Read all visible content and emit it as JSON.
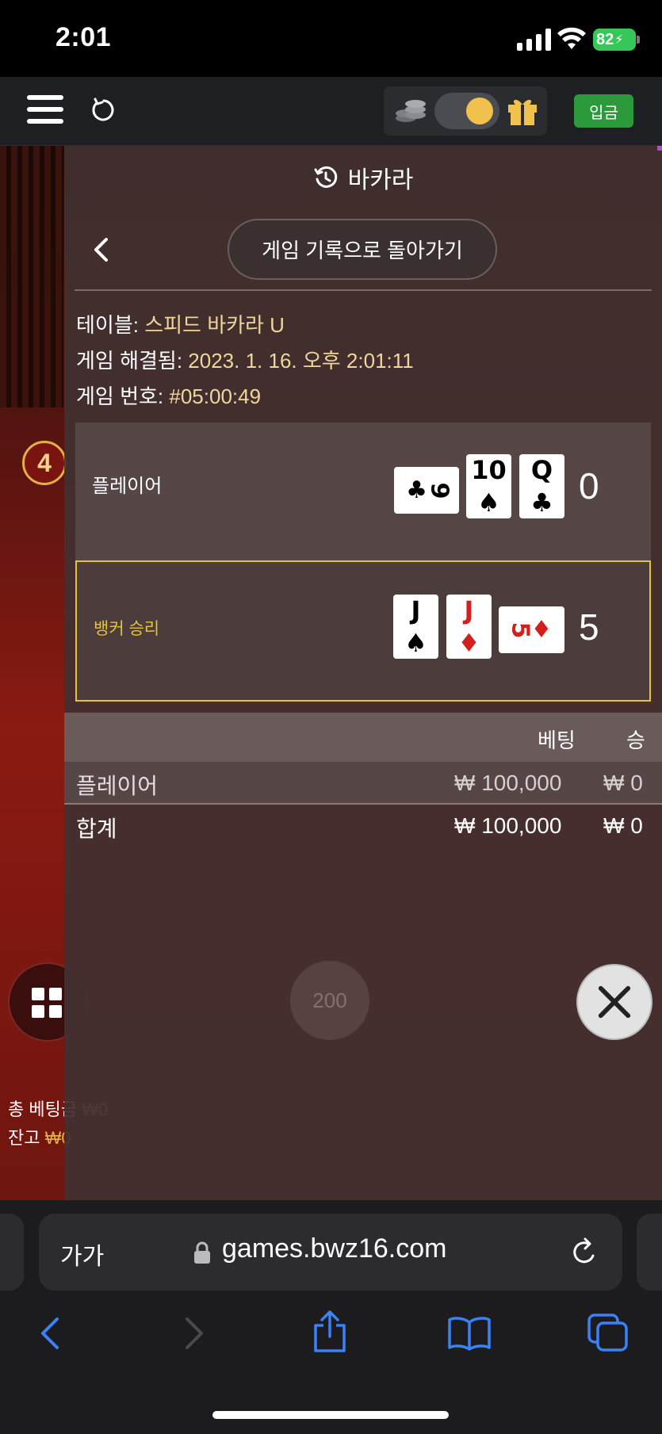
{
  "status_bar": {
    "time": "2:01",
    "battery": "82"
  },
  "header": {
    "deposit_label": "입금"
  },
  "scene": {
    "badge": "4",
    "line1_prefix": "총 베팅금",
    "line1_value": "₩0",
    "line2_prefix": "잔고",
    "line2_value": "₩0",
    "chip": "200"
  },
  "panel": {
    "title": "바카라",
    "back_button": "게임 기록으로 돌아가기",
    "info": {
      "table_label": "테이블:",
      "table_value": "스피드 바카라 U",
      "resolved_label": "게임 해결됨:",
      "resolved_value": "2023. 1. 16. 오후 2:01:11",
      "number_label": "게임 번호:",
      "number_value": "#05:00:49"
    },
    "player": {
      "label": "플레이어",
      "score": "0",
      "cards": [
        {
          "rank": "9",
          "suit": "♣",
          "color": "#000000"
        },
        {
          "rank": "10",
          "suit": "♠",
          "color": "#000000"
        },
        {
          "rank": "Q",
          "suit": "♣",
          "color": "#000000"
        }
      ]
    },
    "banker": {
      "label": "뱅커 승리",
      "score": "5",
      "cards": [
        {
          "rank": "J",
          "suit": "♠",
          "color": "#000000"
        },
        {
          "rank": "J",
          "suit": "♦",
          "color": "#d2201d"
        },
        {
          "rank": "5",
          "suit": "♦",
          "color": "#d2201d"
        }
      ]
    },
    "bets": {
      "col_bet": "베팅",
      "col_win": "승",
      "rows": [
        {
          "name": "플레이어",
          "bet": "₩ 100,000",
          "win": "₩ 0"
        },
        {
          "name": "합계",
          "bet": "₩ 100,000",
          "win": "₩ 0"
        }
      ]
    }
  },
  "browser": {
    "aa_label": "가가",
    "url": "games.bwz16.com"
  },
  "colors": {
    "accent_gold": "#e3c33b",
    "deposit_green": "#2c9a3a",
    "info_value": "#f0d69a",
    "ios_blue": "#3a82f7"
  }
}
